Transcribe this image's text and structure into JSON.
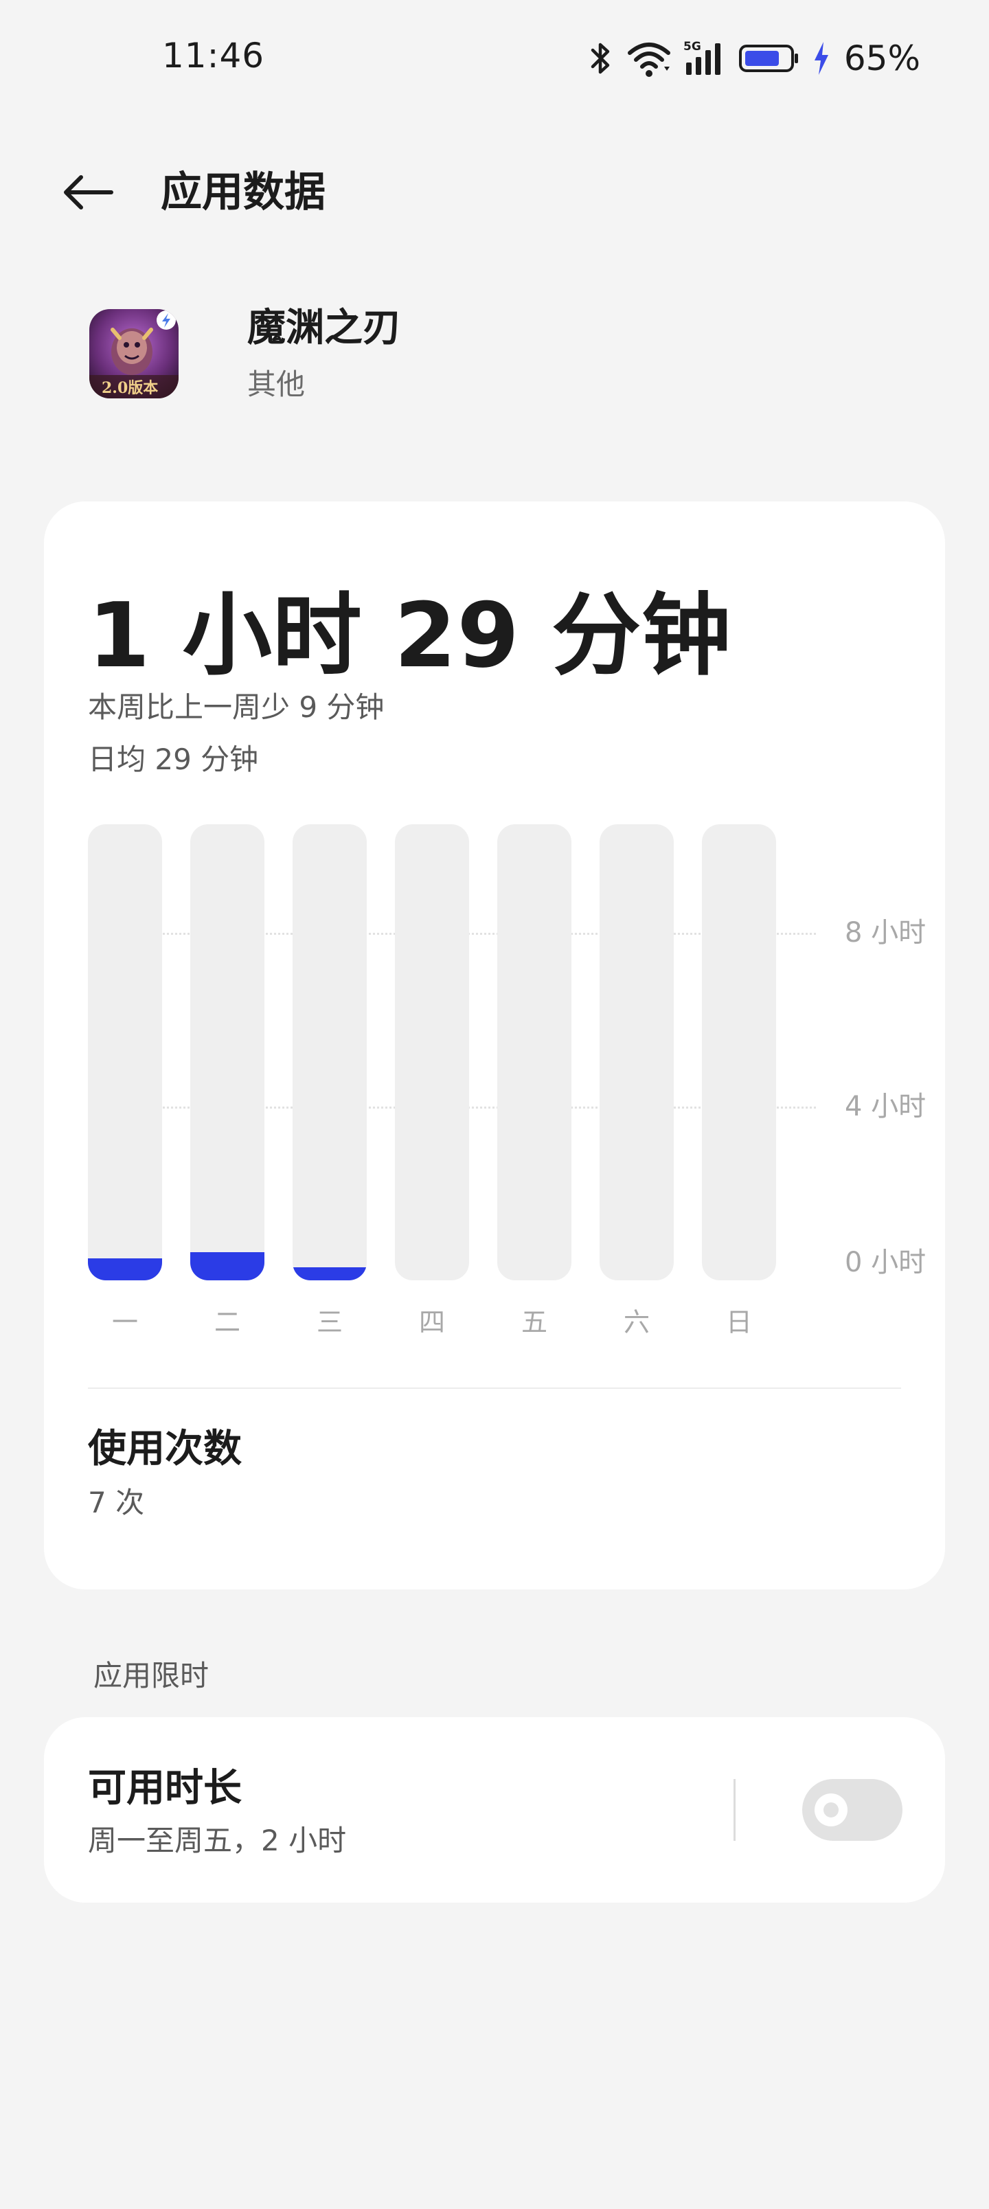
{
  "status_bar": {
    "time": "11:46",
    "battery_percent": "65%",
    "icons": [
      "bluetooth-icon",
      "wifi-icon",
      "cellular-5g-icon",
      "battery-icon",
      "charging-bolt-icon"
    ],
    "network_label": "5G"
  },
  "header": {
    "title": "应用数据",
    "back_icon": "arrow-left-icon"
  },
  "app": {
    "name": "魔渊之刃",
    "category": "其他",
    "icon_badge": "2.0版本"
  },
  "usage": {
    "total_time": "1 小时 29 分钟",
    "comparison": "本周比上一周少 9 分钟",
    "daily_average": "日均 29 分钟"
  },
  "chart_data": {
    "type": "bar",
    "categories": [
      "一",
      "二",
      "三",
      "四",
      "五",
      "六",
      "日"
    ],
    "values": [
      0.5,
      0.65,
      0.3,
      0,
      0,
      0,
      0
    ],
    "unit": "小时",
    "yticks": [
      {
        "value": 0,
        "label": "0 小时"
      },
      {
        "value": 4,
        "label": "4 小时"
      },
      {
        "value": 8,
        "label": "8 小时"
      }
    ],
    "ylim": [
      0,
      10.5
    ],
    "grid": true,
    "bar_color": "#2b3ce6",
    "track_color": "#efefef"
  },
  "launches": {
    "title": "使用次数",
    "value": "7 次"
  },
  "limit_section": {
    "label": "应用限时",
    "title": "可用时长",
    "subtitle": "周一至周五，2 小时",
    "enabled": false
  },
  "colors": {
    "accent": "#2b3ce6",
    "background": "#f4f4f4",
    "card": "#ffffff"
  }
}
